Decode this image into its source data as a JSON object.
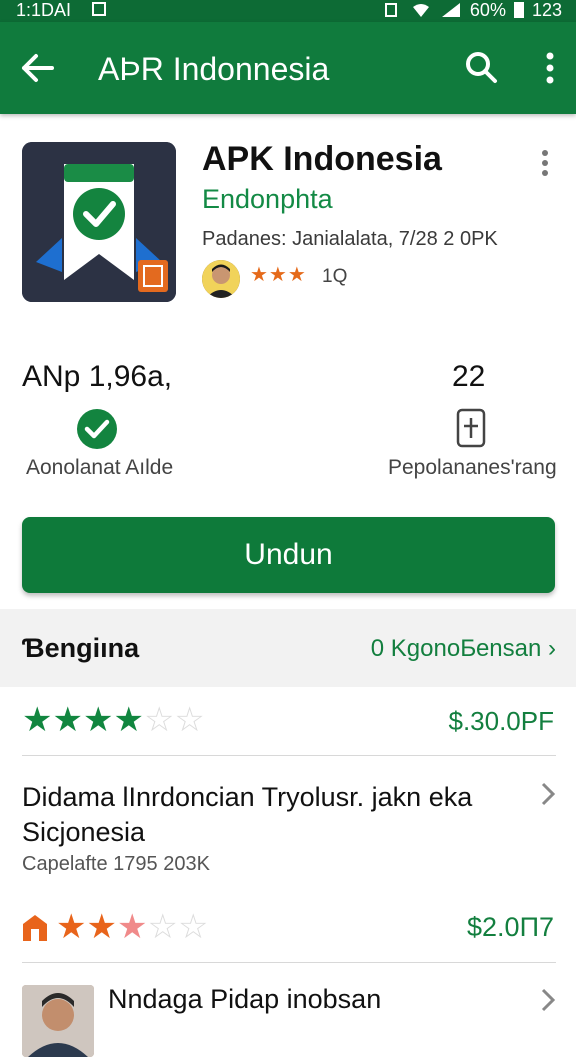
{
  "status_bar": {
    "time": "1:1DAI",
    "battery_percent": "60%",
    "clock_right": "123"
  },
  "app_bar": {
    "title": "AÞR Indonnesia",
    "icons": [
      "arrow-back-icon",
      "search-icon",
      "more-vert-icon"
    ]
  },
  "app": {
    "name": "APK Indonesia",
    "developer": "Endonphta",
    "details": "Padanes: Janialalata,  7/28 2 0PK",
    "rating_stars": "★★★",
    "rating_count": "1Q",
    "icon": "shield-check-icon"
  },
  "stats": {
    "left_value": "ANp 1,96a,",
    "left_label": "Aonolanat Aılde",
    "right_value": "22",
    "right_label": "Pepolananes'rang"
  },
  "install_button": {
    "label": "Undun"
  },
  "section": {
    "title": "Ɓengiına",
    "link": "0 KgonoƂensan ›"
  },
  "rows": [
    {
      "rating": 4,
      "max": 6,
      "price": "$.30.0PF"
    },
    {
      "title": "Didama lInrdoncian Tryolusr. jakn eka Sicjonesia",
      "subtitle": "Capelafte 1795 203K"
    },
    {
      "rating": 2.5,
      "max": 5,
      "price": "$2.0П7"
    },
    {
      "title": "Nndaga Pidap inobsan"
    }
  ],
  "colors": {
    "primary": "#107b3d",
    "accent_orange": "#e8641b",
    "accent_text": "#137f3f"
  }
}
